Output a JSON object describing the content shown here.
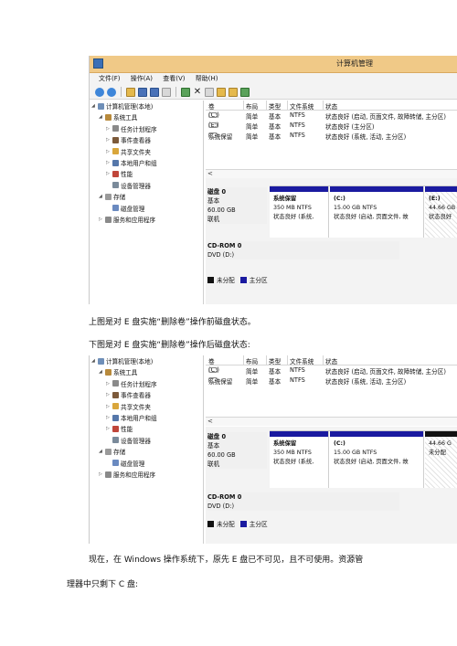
{
  "window_title": "计算机管理",
  "menu": [
    "文件(F)",
    "操作(A)",
    "查看(V)",
    "帮助(H)"
  ],
  "tree": [
    {
      "label": "计算机管理(本地)",
      "indent": 0,
      "arrow": "◢",
      "icon": "computer-icon",
      "color": "#6f8fb8"
    },
    {
      "label": "系统工具",
      "indent": 1,
      "arrow": "◢",
      "icon": "tools-icon",
      "color": "#b88a3c"
    },
    {
      "label": "任务计划程序",
      "indent": 2,
      "arrow": "▷",
      "icon": "clock-icon",
      "color": "#8a8a8a"
    },
    {
      "label": "事件查看器",
      "indent": 2,
      "arrow": "▷",
      "icon": "event-log-icon",
      "color": "#7c5a3a"
    },
    {
      "label": "共享文件夹",
      "indent": 2,
      "arrow": "▷",
      "icon": "shared-folder-icon",
      "color": "#d9a63b"
    },
    {
      "label": "本地用户和组",
      "indent": 2,
      "arrow": "▷",
      "icon": "users-icon",
      "color": "#5577aa"
    },
    {
      "label": "性能",
      "indent": 2,
      "arrow": "▷",
      "icon": "performance-icon",
      "color": "#c0463a"
    },
    {
      "label": "设备管理器",
      "indent": 2,
      "arrow": "",
      "icon": "device-manager-icon",
      "color": "#7a8a9a"
    },
    {
      "label": "存储",
      "indent": 1,
      "arrow": "◢",
      "icon": "storage-icon",
      "color": "#9a9a9a"
    },
    {
      "label": "磁盘管理",
      "indent": 2,
      "arrow": "",
      "icon": "disk-management-icon",
      "color": "#6a8ac0"
    },
    {
      "label": "服务和应用程序",
      "indent": 1,
      "arrow": "▷",
      "icon": "services-icon",
      "color": "#8a8a8a"
    }
  ],
  "volume_headers": [
    "卷",
    "布局",
    "类型",
    "文件系统",
    "状态"
  ],
  "volumes_before": [
    {
      "name": "(C:)",
      "layout": "简单",
      "type": "基本",
      "fs": "NTFS",
      "status": "状态良好 (启动, 页面文件, 故障转储, 主分区)"
    },
    {
      "name": "(E:)",
      "layout": "简单",
      "type": "基本",
      "fs": "NTFS",
      "status": "状态良好 (主分区)"
    },
    {
      "name": "系统保留",
      "layout": "简单",
      "type": "基本",
      "fs": "NTFS",
      "status": "状态良好 (系统, 活动, 主分区)"
    }
  ],
  "volumes_after": [
    {
      "name": "(C:)",
      "layout": "简单",
      "type": "基本",
      "fs": "NTFS",
      "status": "状态良好 (启动, 页面文件, 故障转储, 主分区)"
    },
    {
      "name": "系统保留",
      "layout": "简单",
      "type": "基本",
      "fs": "NTFS",
      "status": "状态良好 (系统, 活动, 主分区)"
    }
  ],
  "scroll_left": "<",
  "disk0": {
    "name": "磁盘 0",
    "type": "基本",
    "size": "60.00 GB",
    "status": "联机"
  },
  "partitions_before": [
    {
      "title": "系统保留",
      "size": "350 MB NTFS",
      "status": "状态良好 (系统,"
    },
    {
      "title": "(C:)",
      "size": "15.00 GB NTFS",
      "status": "状态良好 (启动, 页面文件, 故"
    },
    {
      "title": "(E:)",
      "size": "44.66 GB",
      "status": "状态良好"
    }
  ],
  "partitions_after": [
    {
      "title": "系统保留",
      "size": "350 MB NTFS",
      "status": "状态良好 (系统,"
    },
    {
      "title": "(C:)",
      "size": "15.00 GB NTFS",
      "status": "状态良好 (启动, 页面文件, 故"
    },
    {
      "title": "",
      "size": "44.66 G",
      "status": "未分配"
    }
  ],
  "cdrom": {
    "name": "CD-ROM 0",
    "drive": "DVD (D:)"
  },
  "legend": [
    {
      "label": "未分配",
      "color": "#111111"
    },
    {
      "label": "主分区",
      "color": "#1a1aa0"
    }
  ],
  "captions": {
    "before": "上图是对 E 盘实施“删除卷”操作前磁盘状态。",
    "after": "下图是对 E 盘实施“删除卷”操作后磁盘状态:",
    "line1": "现在，在 Windows 操作系统下，原先 E 盘已不可见，且不可使用。资源管",
    "line2": "理器中只剩下 C 盘:"
  }
}
